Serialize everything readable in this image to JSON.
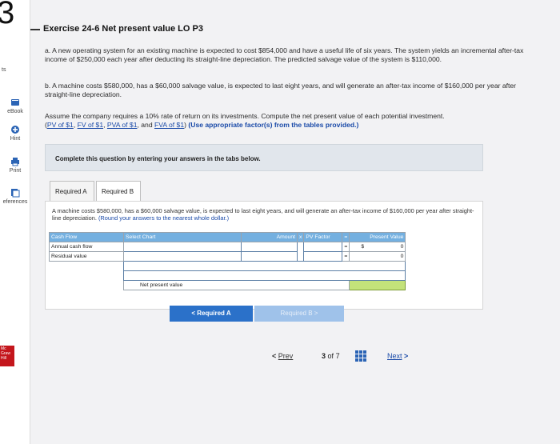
{
  "sidebar": {
    "question_number": "3",
    "points": "ts",
    "tools": [
      {
        "label": "eBook",
        "icon": "book-icon"
      },
      {
        "label": "Hint",
        "icon": "hint-icon"
      },
      {
        "label": "Print",
        "icon": "print-icon"
      },
      {
        "label": "eferences",
        "icon": "references-icon"
      }
    ],
    "logo": "Mc Graw Hill Education"
  },
  "exercise": {
    "title": "Exercise 24-6 Net present value LO P3",
    "part_a": "a. A new operating system for an existing machine is expected to cost $854,000 and have a useful life of six years. The system yields an incremental after-tax income of $250,000 each year after deducting its straight-line depreciation. The predicted salvage value of the system is $110,000.",
    "part_b": "b. A machine costs $580,000, has a $60,000 salvage value, is expected to last eight years, and will generate an after-tax income of $160,000 per year after straight-line depreciation.",
    "assume": "Assume the company requires a 10% rate of return on its investments. Compute the net present value of each potential investment.",
    "links": [
      "PV of $1",
      "FV of $1",
      "PVA of $1",
      "FVA of $1"
    ],
    "sep1": ", ",
    "sep3": ", and ",
    "link_open": "(",
    "link_close": ")",
    "emphasis": "(Use appropriate factor(s) from the tables provided.)"
  },
  "instructions": "Complete this question by entering your answers in the tabs below.",
  "tabs": [
    {
      "label": "Required A"
    },
    {
      "label": "Required B"
    }
  ],
  "panel": {
    "description": "A machine costs $580,000, has a $60,000 salvage value, is expected to last eight years, and will generate an after-tax income of $160,000 per year after straight-line depreciation.",
    "rounding": "(Round your answers to the nearest whole dollar.)",
    "table": {
      "headers": {
        "cash_flow": "Cash Flow",
        "select_chart": "Select Chart",
        "amount": "Amount",
        "x": "x",
        "pv_factor": "PV Factor",
        "eq": "=",
        "present_value": "Present Value"
      },
      "rows": [
        {
          "label": "Annual cash flow",
          "select_chart": "",
          "amount": "",
          "pv_factor": "",
          "eq": "=",
          "currency": "$",
          "value": "0"
        },
        {
          "label": "Residual value",
          "select_chart": "",
          "amount": "",
          "pv_factor": "",
          "eq": "=",
          "currency": "",
          "value": "0"
        }
      ],
      "npv_label": "Net present value"
    }
  },
  "nav": {
    "prev_label": "Required A",
    "prev_arrow": "<",
    "next_label": "Required B",
    "next_arrow": ">"
  },
  "pager": {
    "prev": "Prev",
    "prev_arrow": "<",
    "current": "3",
    "of": "of",
    "total": "7",
    "next": "Next",
    "next_arrow": ">"
  },
  "colors": {
    "header_blue": "#74b0e0",
    "button_blue": "#2b71c9",
    "button_disabled": "#9fc2ea",
    "npv_green": "#c3e27a",
    "link_blue": "#1a4aa8"
  }
}
